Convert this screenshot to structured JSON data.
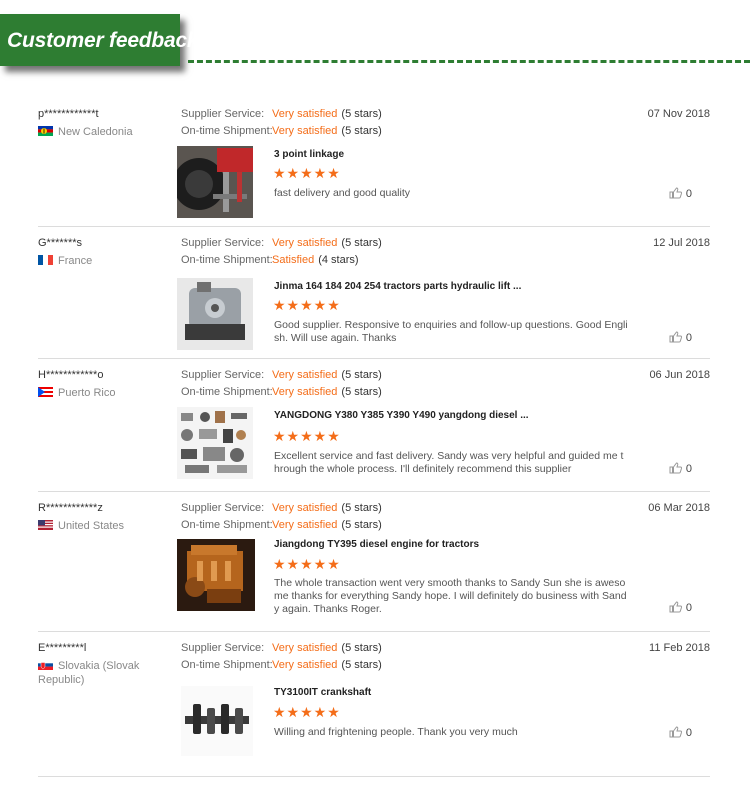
{
  "header": {
    "title": "Customer feedback",
    "accent_color": "#2e7d32"
  },
  "labels": {
    "supplier_service": "Supplier Service:",
    "ontime_shipment": "On-time Shipment:"
  },
  "rating_color": "#f46d19",
  "reviews": [
    {
      "username": "p************t",
      "country": "New Caledonia",
      "flag_icon": "new-caledonia-flag-icon",
      "supplier_rating": "Very satisfied",
      "supplier_stars": "(5 stars)",
      "shipment_rating": "Very satisfied",
      "shipment_stars": "(5 stars)",
      "date": "07 Nov 2018",
      "product": "3 point linkage",
      "product_image_icon": "tractor-linkage-icon",
      "stars": "★★★★★",
      "star_count": 5,
      "comment": "fast delivery and good quality",
      "likes": "0"
    },
    {
      "username": "G*******s",
      "country": "France",
      "flag_icon": "france-flag-icon",
      "supplier_rating": "Very satisfied",
      "supplier_stars": "(5 stars)",
      "shipment_rating": "Satisfied",
      "shipment_stars": "(4 stars)",
      "date": "12 Jul 2018",
      "product": "Jinma 164 184 204 254 tractors parts hydraulic lift ...",
      "product_image_icon": "hydraulic-pump-icon",
      "stars": "★★★★★",
      "star_count": 5,
      "comment": "Good supplier.  Responsive to enquiries and follow-up questions.  Good Engli sh.  Will use again.  Thanks",
      "likes": "0"
    },
    {
      "username": "H************o",
      "country": "Puerto Rico",
      "flag_icon": "puerto-rico-flag-icon",
      "supplier_rating": "Very satisfied",
      "supplier_stars": "(5 stars)",
      "shipment_rating": "Very satisfied",
      "shipment_stars": "(5 stars)",
      "date": "06 Jun 2018",
      "product": "YANGDONG Y380 Y385 Y390 Y490 yangdong diesel ...",
      "product_image_icon": "engine-parts-icon",
      "stars": "★★★★★",
      "star_count": 5,
      "comment": "Excellent service and fast delivery.  Sandy was very helpful and guided me t hrough the whole process.  I'll definitely recommend this supplier",
      "likes": "0"
    },
    {
      "username": "R************z",
      "country": "United States",
      "flag_icon": "united-states-flag-icon",
      "supplier_rating": "Very satisfied",
      "supplier_stars": "(5 stars)",
      "shipment_rating": "Very satisfied",
      "shipment_stars": "(5 stars)",
      "date": "06 Mar 2018",
      "product": "Jiangdong TY395 diesel engine for tractors",
      "product_image_icon": "diesel-engine-icon",
      "stars": "★★★★★",
      "star_count": 5,
      "comment": "The whole transaction went very smooth thanks to Sandy Sun she is aweso me thanks for everything Sandy hope. I will definitely do business with Sand y again. Thanks Roger.",
      "likes": "0"
    },
    {
      "username": "E*********l",
      "country": "Slovakia (Slovak Republic)",
      "flag_icon": "slovakia-flag-icon",
      "supplier_rating": "Very satisfied",
      "supplier_stars": "(5 stars)",
      "shipment_rating": "Very satisfied",
      "shipment_stars": "(5 stars)",
      "date": "11 Feb 2018",
      "product": "TY3100IT crankshaft",
      "product_image_icon": "crankshaft-icon",
      "stars": "★★★★★",
      "star_count": 5,
      "comment": "Willing and frightening people. Thank you very much",
      "likes": "0"
    }
  ]
}
